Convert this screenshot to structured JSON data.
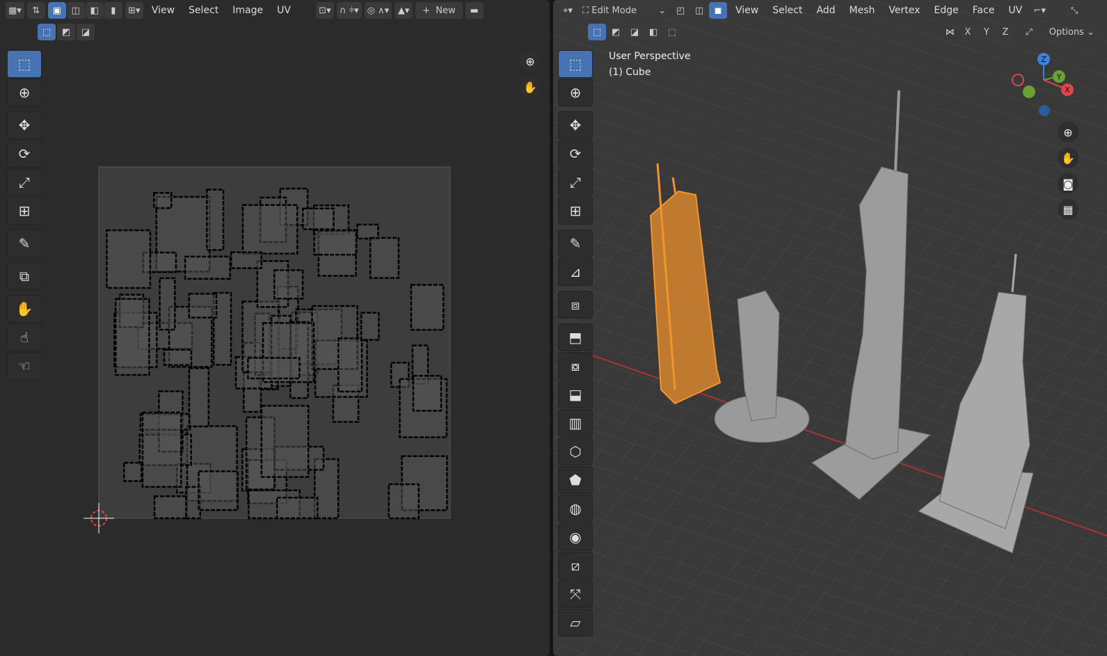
{
  "uv_editor": {
    "menus": [
      "View",
      "Select",
      "Image",
      "UV"
    ],
    "new_label": "New",
    "tools": [
      "select-box",
      "cursor",
      "move",
      "rotate",
      "scale",
      "transform",
      "annotate",
      "rip",
      "grab",
      "relax",
      "pinch"
    ]
  },
  "viewport": {
    "mode": "Edit Mode",
    "menus": [
      "View",
      "Select",
      "Add",
      "Mesh",
      "Vertex",
      "Edge",
      "Face",
      "UV"
    ],
    "axes": [
      "X",
      "Y",
      "Z"
    ],
    "options_label": "Options",
    "overlay_title": "User Perspective",
    "overlay_object": "(1) Cube",
    "gizmo": {
      "x": "X",
      "y": "Y",
      "z": "Z"
    },
    "colors": {
      "x": "#e0444e",
      "y": "#6ca033",
      "z": "#3a82d8",
      "selected": "#e8892a"
    }
  }
}
